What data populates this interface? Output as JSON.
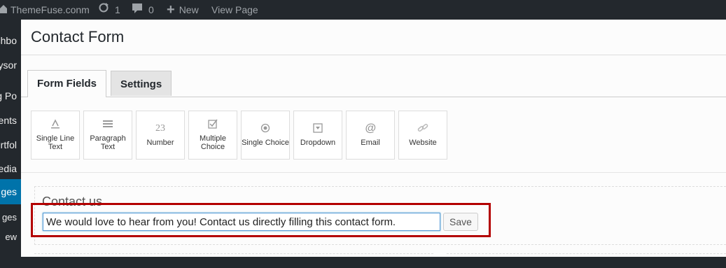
{
  "adminbar": {
    "site_name": "ThemeFuse.conm",
    "updates_count": "1",
    "comments_count": "0",
    "new_label": "New",
    "view_page_label": "View Page"
  },
  "sidebar": {
    "items": [
      "shbo",
      "ysor",
      "og Po",
      "ents",
      "rtfol",
      "edia",
      "ges",
      "ges",
      "ew"
    ]
  },
  "modal": {
    "title": "Contact Form",
    "tabs": [
      {
        "label": "Form Fields"
      },
      {
        "label": "Settings"
      }
    ],
    "field_types": [
      {
        "label": "Single Line Text",
        "icon": "text-icon"
      },
      {
        "label": "Paragraph Text",
        "icon": "paragraph-icon"
      },
      {
        "label": "Number",
        "icon": "number-icon"
      },
      {
        "label": "Multiple Choice",
        "icon": "checkbox-icon"
      },
      {
        "label": "Single Choice",
        "icon": "radio-icon"
      },
      {
        "label": "Dropdown",
        "icon": "dropdown-icon"
      },
      {
        "label": "Email",
        "icon": "at-icon"
      },
      {
        "label": "Website",
        "icon": "link-icon"
      }
    ],
    "form": {
      "title": "Contact us",
      "description_value": "We would love to hear from you! Contact us directly filling this contact form.",
      "save_label": "Save"
    }
  },
  "colors": {
    "adminbar_bg": "#23282d",
    "highlight": "#b30000",
    "active_menu": "#0073aa"
  }
}
